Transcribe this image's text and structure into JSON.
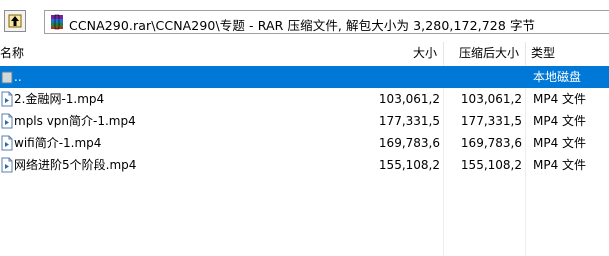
{
  "address_bar": {
    "path": "CCNA290.rar\\CCNA290\\专题 - RAR 压缩文件, 解包大小为 3,280,172,728 字节"
  },
  "columns": {
    "name": "名称",
    "size": "大小",
    "packed": "压缩后大小",
    "type": "类型"
  },
  "files": [
    {
      "name": "..",
      "size": "",
      "packed": "",
      "type": "本地磁盘",
      "selected": true,
      "kind": "parent"
    },
    {
      "name": "2.金融网-1.mp4",
      "size": "103,061,2",
      "packed": "103,061,2",
      "type": "MP4 文件",
      "kind": "file"
    },
    {
      "name": "mpls vpn简介-1.mp4",
      "size": "177,331,5",
      "packed": "177,331,5",
      "type": "MP4 文件",
      "kind": "file"
    },
    {
      "name": "wifi简介-1.mp4",
      "size": "169,783,6",
      "packed": "169,783,6",
      "type": "MP4 文件",
      "kind": "file"
    },
    {
      "name": "网络进阶5个阶段.mp4",
      "size": "155,108,2",
      "packed": "155,108,2",
      "type": "MP4 文件",
      "kind": "file"
    }
  ],
  "colors": {
    "selection": "#0078d7"
  }
}
